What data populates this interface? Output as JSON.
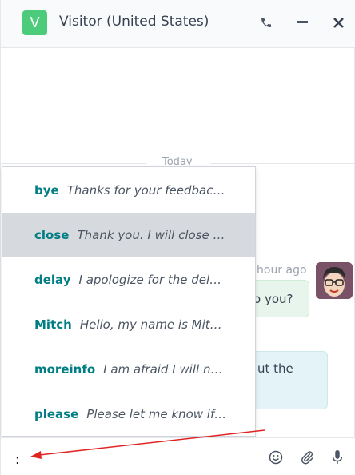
{
  "header": {
    "avatar_letter": "V",
    "title": "Visitor (United States)",
    "icons": [
      "phone-icon",
      "minimize-icon",
      "close-icon"
    ]
  },
  "thread": {
    "day_separator": "Today",
    "time_fragment": "hour ago",
    "bubble1_fragment": "o you?",
    "bubble2_fragment": "ut the"
  },
  "canned_responses": [
    {
      "keyword": "bye",
      "text": "Thanks for your feedbac…"
    },
    {
      "keyword": "close",
      "text": "Thank you. I will close …",
      "selected": true
    },
    {
      "keyword": "delay",
      "text": "I apologize for the del…"
    },
    {
      "keyword": "Mitch",
      "text": "Hello, my name is Mit…"
    },
    {
      "keyword": "moreinfo",
      "text": "I am afraid I will n…"
    },
    {
      "keyword": "please",
      "text": "Please let me know if…"
    }
  ],
  "composer": {
    "value": ":"
  },
  "colors": {
    "keyword": "#017e84",
    "selected_bg": "#d6d9dd",
    "avatar_bg": "#4ccb7a",
    "arrow": "#e02424"
  }
}
